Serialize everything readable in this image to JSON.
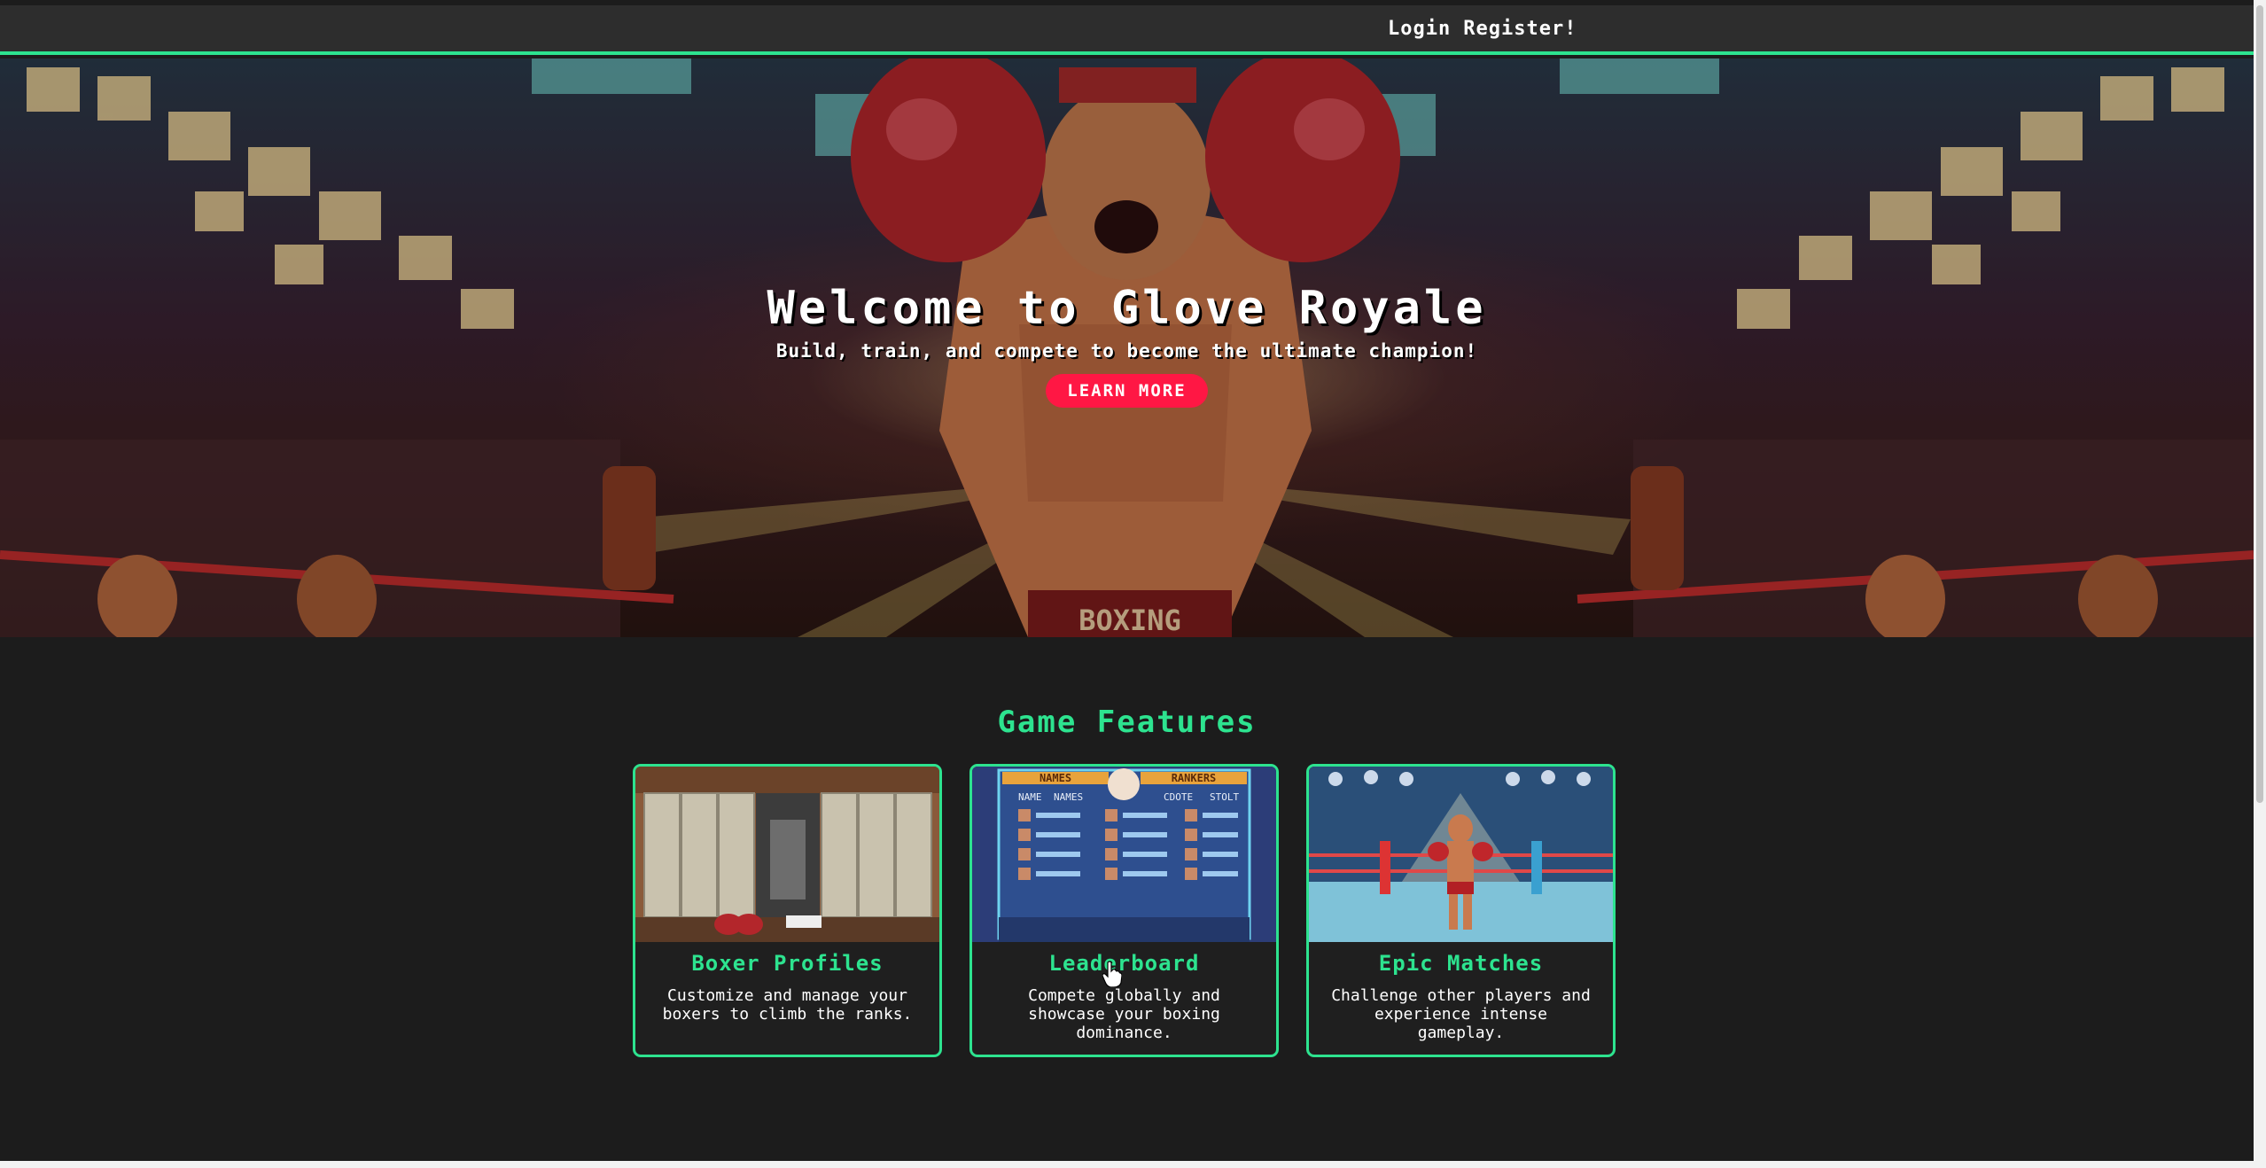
{
  "nav": {
    "login_label": "Login",
    "register_label": "Register!"
  },
  "hero": {
    "title": "Welcome to Glove Royale",
    "subtitle": "Build, train, and compete to become the ultimate champion!",
    "cta_label": "LEARN MORE"
  },
  "features": {
    "title": "Game Features",
    "cards": [
      {
        "title": "Boxer Profiles",
        "description": "Customize and manage your boxers to climb the ranks.",
        "image": "locker-room-illustration"
      },
      {
        "title": "Leaderboard",
        "description": "Compete globally and showcase your boxing dominance.",
        "image": "leaderboard-illustration",
        "image_text": {
          "names_banner": "NAMES",
          "rankings_banner": "RANKERS",
          "col_name": "NAME",
          "col_names": "NAMES",
          "col_score": "CDOTE",
          "col_stat": "STOLT"
        }
      },
      {
        "title": "Epic Matches",
        "description": "Challenge other players and experience intense gameplay.",
        "image": "boxing-ring-illustration"
      }
    ]
  },
  "hero_image_text": "BOXING",
  "colors": {
    "accent": "#2de38f",
    "cta": "#ff1744",
    "background": "#1c1c1c",
    "topbar": "#2d2d2d"
  }
}
